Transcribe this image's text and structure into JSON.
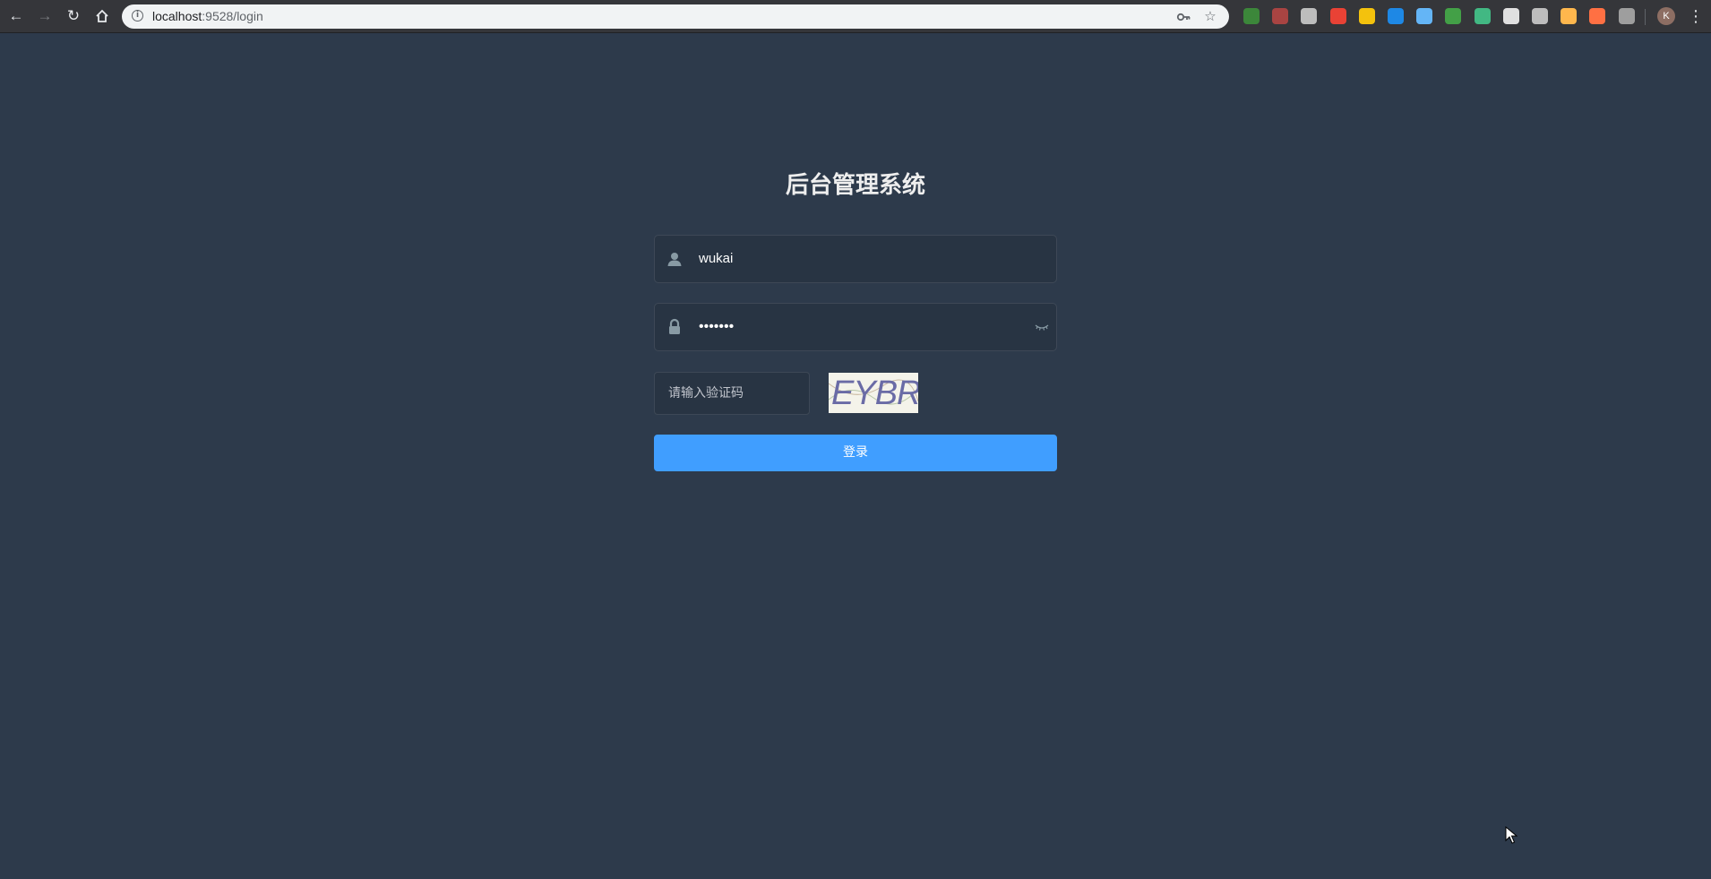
{
  "browser": {
    "url_host": "localhost",
    "url_path": ":9528/login",
    "avatar_letter": "K",
    "nav": {
      "back_icon": "arrow-left-icon",
      "forward_icon": "arrow-right-icon",
      "reload_icon": "reload-icon",
      "home_icon": "home-icon"
    }
  },
  "login": {
    "title": "后台管理系统",
    "username": "wukai",
    "password_mask": "•••••••",
    "captcha_placeholder": "请输入验证码",
    "captcha_text": "EYBR",
    "submit_label": "登录"
  },
  "colors": {
    "page_bg": "#2d3a4b",
    "input_bg": "#283443",
    "button": "#409eff",
    "title": "#eeeeee"
  },
  "extensions": [
    {
      "name": "node-ext-icon",
      "color": "#3c873a"
    },
    {
      "name": "bookmark-ext-icon",
      "color": "#a94442"
    },
    {
      "name": "screen-ext-icon",
      "color": "#bdbdbd"
    },
    {
      "name": "colorzilla-ext-icon",
      "color": "#e94235"
    },
    {
      "name": "note-ext-icon",
      "color": "#f4c20d"
    },
    {
      "name": "bird-ext-icon",
      "color": "#1e88e5"
    },
    {
      "name": "gem-ext-icon",
      "color": "#64b5f6"
    },
    {
      "name": "shield-ext-icon",
      "color": "#43a047"
    },
    {
      "name": "vue-ext-icon",
      "color": "#42b883"
    },
    {
      "name": "react-ext-icon",
      "color": "#e0e0e0"
    },
    {
      "name": "target-ext-icon",
      "color": "#bdbdbd"
    },
    {
      "name": "face-ext-icon",
      "color": "#ffb74d"
    },
    {
      "name": "bird2-ext-icon",
      "color": "#ff7043"
    },
    {
      "name": "signal-ext-icon",
      "color": "#9e9e9e"
    }
  ]
}
